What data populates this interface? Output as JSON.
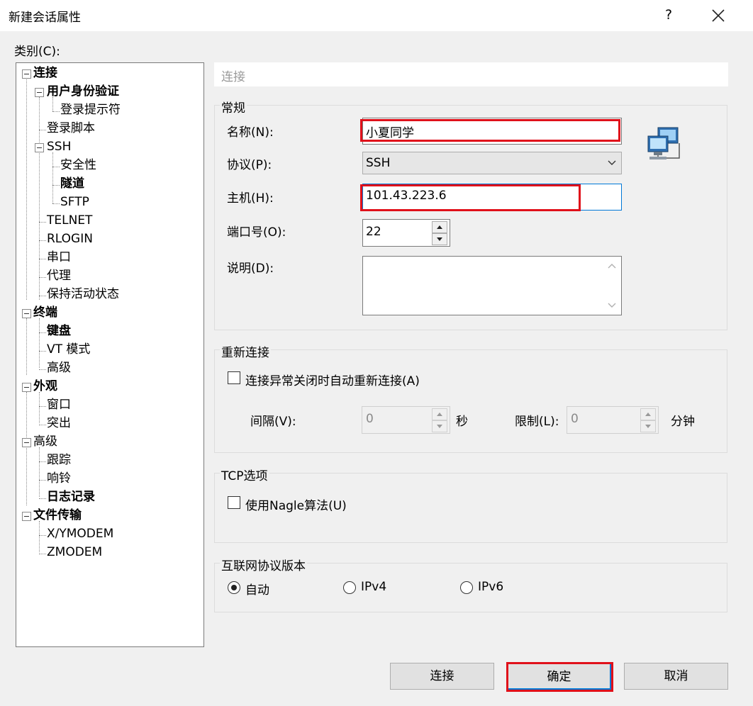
{
  "window": {
    "title": "新建会话属性",
    "help": "?"
  },
  "category_label": "类别(C):",
  "tree": [
    {
      "label": "连接",
      "bold": true
    },
    {
      "label": "用户身份验证",
      "bold": true
    },
    {
      "label": "登录提示符",
      "bold": false
    },
    {
      "label": "登录脚本",
      "bold": false
    },
    {
      "label": "SSH",
      "bold": false
    },
    {
      "label": "安全性",
      "bold": false
    },
    {
      "label": "隧道",
      "bold": true
    },
    {
      "label": "SFTP",
      "bold": false
    },
    {
      "label": "TELNET",
      "bold": false
    },
    {
      "label": "RLOGIN",
      "bold": false
    },
    {
      "label": "串口",
      "bold": false
    },
    {
      "label": "代理",
      "bold": false
    },
    {
      "label": "保持活动状态",
      "bold": false
    },
    {
      "label": "终端",
      "bold": true
    },
    {
      "label": "键盘",
      "bold": true
    },
    {
      "label": "VT 模式",
      "bold": false
    },
    {
      "label": "高级",
      "bold": false
    },
    {
      "label": "外观",
      "bold": true
    },
    {
      "label": "窗口",
      "bold": false
    },
    {
      "label": "突出",
      "bold": false
    },
    {
      "label": "高级",
      "bold": false
    },
    {
      "label": "跟踪",
      "bold": false
    },
    {
      "label": "响铃",
      "bold": false
    },
    {
      "label": "日志记录",
      "bold": true
    },
    {
      "label": "文件传输",
      "bold": true
    },
    {
      "label": "X/YMODEM",
      "bold": false
    },
    {
      "label": "ZMODEM",
      "bold": false
    }
  ],
  "panel": {
    "header": "连接"
  },
  "general": {
    "title": "常规",
    "name_label": "名称(N):",
    "name_value": "小夏同学",
    "protocol_label": "协议(P):",
    "protocol_value": "SSH",
    "host_label": "主机(H):",
    "host_value": "101.43.223.6",
    "port_label": "端口号(O):",
    "port_value": "22",
    "desc_label": "说明(D):",
    "desc_value": ""
  },
  "reconnect": {
    "title": "重新连接",
    "checkbox_label": "连接异常关闭时自动重新连接(A)",
    "checked": false,
    "interval_label": "间隔(V):",
    "interval_value": "0",
    "interval_unit": "秒",
    "limit_label": "限制(L):",
    "limit_value": "0",
    "limit_unit": "分钟"
  },
  "tcp": {
    "title": "TCP选项",
    "nagle_label": "使用Nagle算法(U)",
    "checked": false
  },
  "ip": {
    "title": "互联网协议版本",
    "options": [
      {
        "label": "自动",
        "selected": true
      },
      {
        "label": "IPv4",
        "selected": false
      },
      {
        "label": "IPv6",
        "selected": false
      }
    ]
  },
  "buttons": {
    "connect": "连接",
    "ok": "确定",
    "cancel": "取消"
  },
  "colors": {
    "highlight": "#e0101a"
  }
}
